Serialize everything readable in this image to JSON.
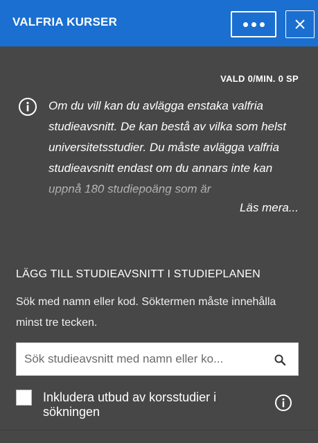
{
  "header": {
    "title": "VALFRIA KURSER",
    "accent_color": "#1a6fd0",
    "more_icon": "more-horizontal-icon",
    "close_icon": "close-icon"
  },
  "status": {
    "selection_text": "VALD 0/MIN. 0 SP"
  },
  "intro": {
    "icon": "info-icon",
    "text": "Om du vill kan du avlägga enstaka valfria studieavsnitt. De kan bestå av vilka som helst universitetsstudier. Du måste avlägga valfria studieavsnitt endast om du annars inte kan uppnå 180 studiepoäng som är",
    "read_more_label": "Läs mera..."
  },
  "add_section": {
    "heading": "LÄGG TILL STUDIEAVSNITT I STUDIEPLANEN",
    "help_text": "Sök med namn eller kod. Söktermen måste innehålla minst tre tecken.",
    "search": {
      "placeholder": "Sök studieavsnitt med namn eller ko...",
      "value": "",
      "icon": "search-icon"
    },
    "cross_studies": {
      "label": "Inkludera utbud av korsstudier i sökningen",
      "checked": false,
      "info_icon": "info-icon"
    }
  }
}
